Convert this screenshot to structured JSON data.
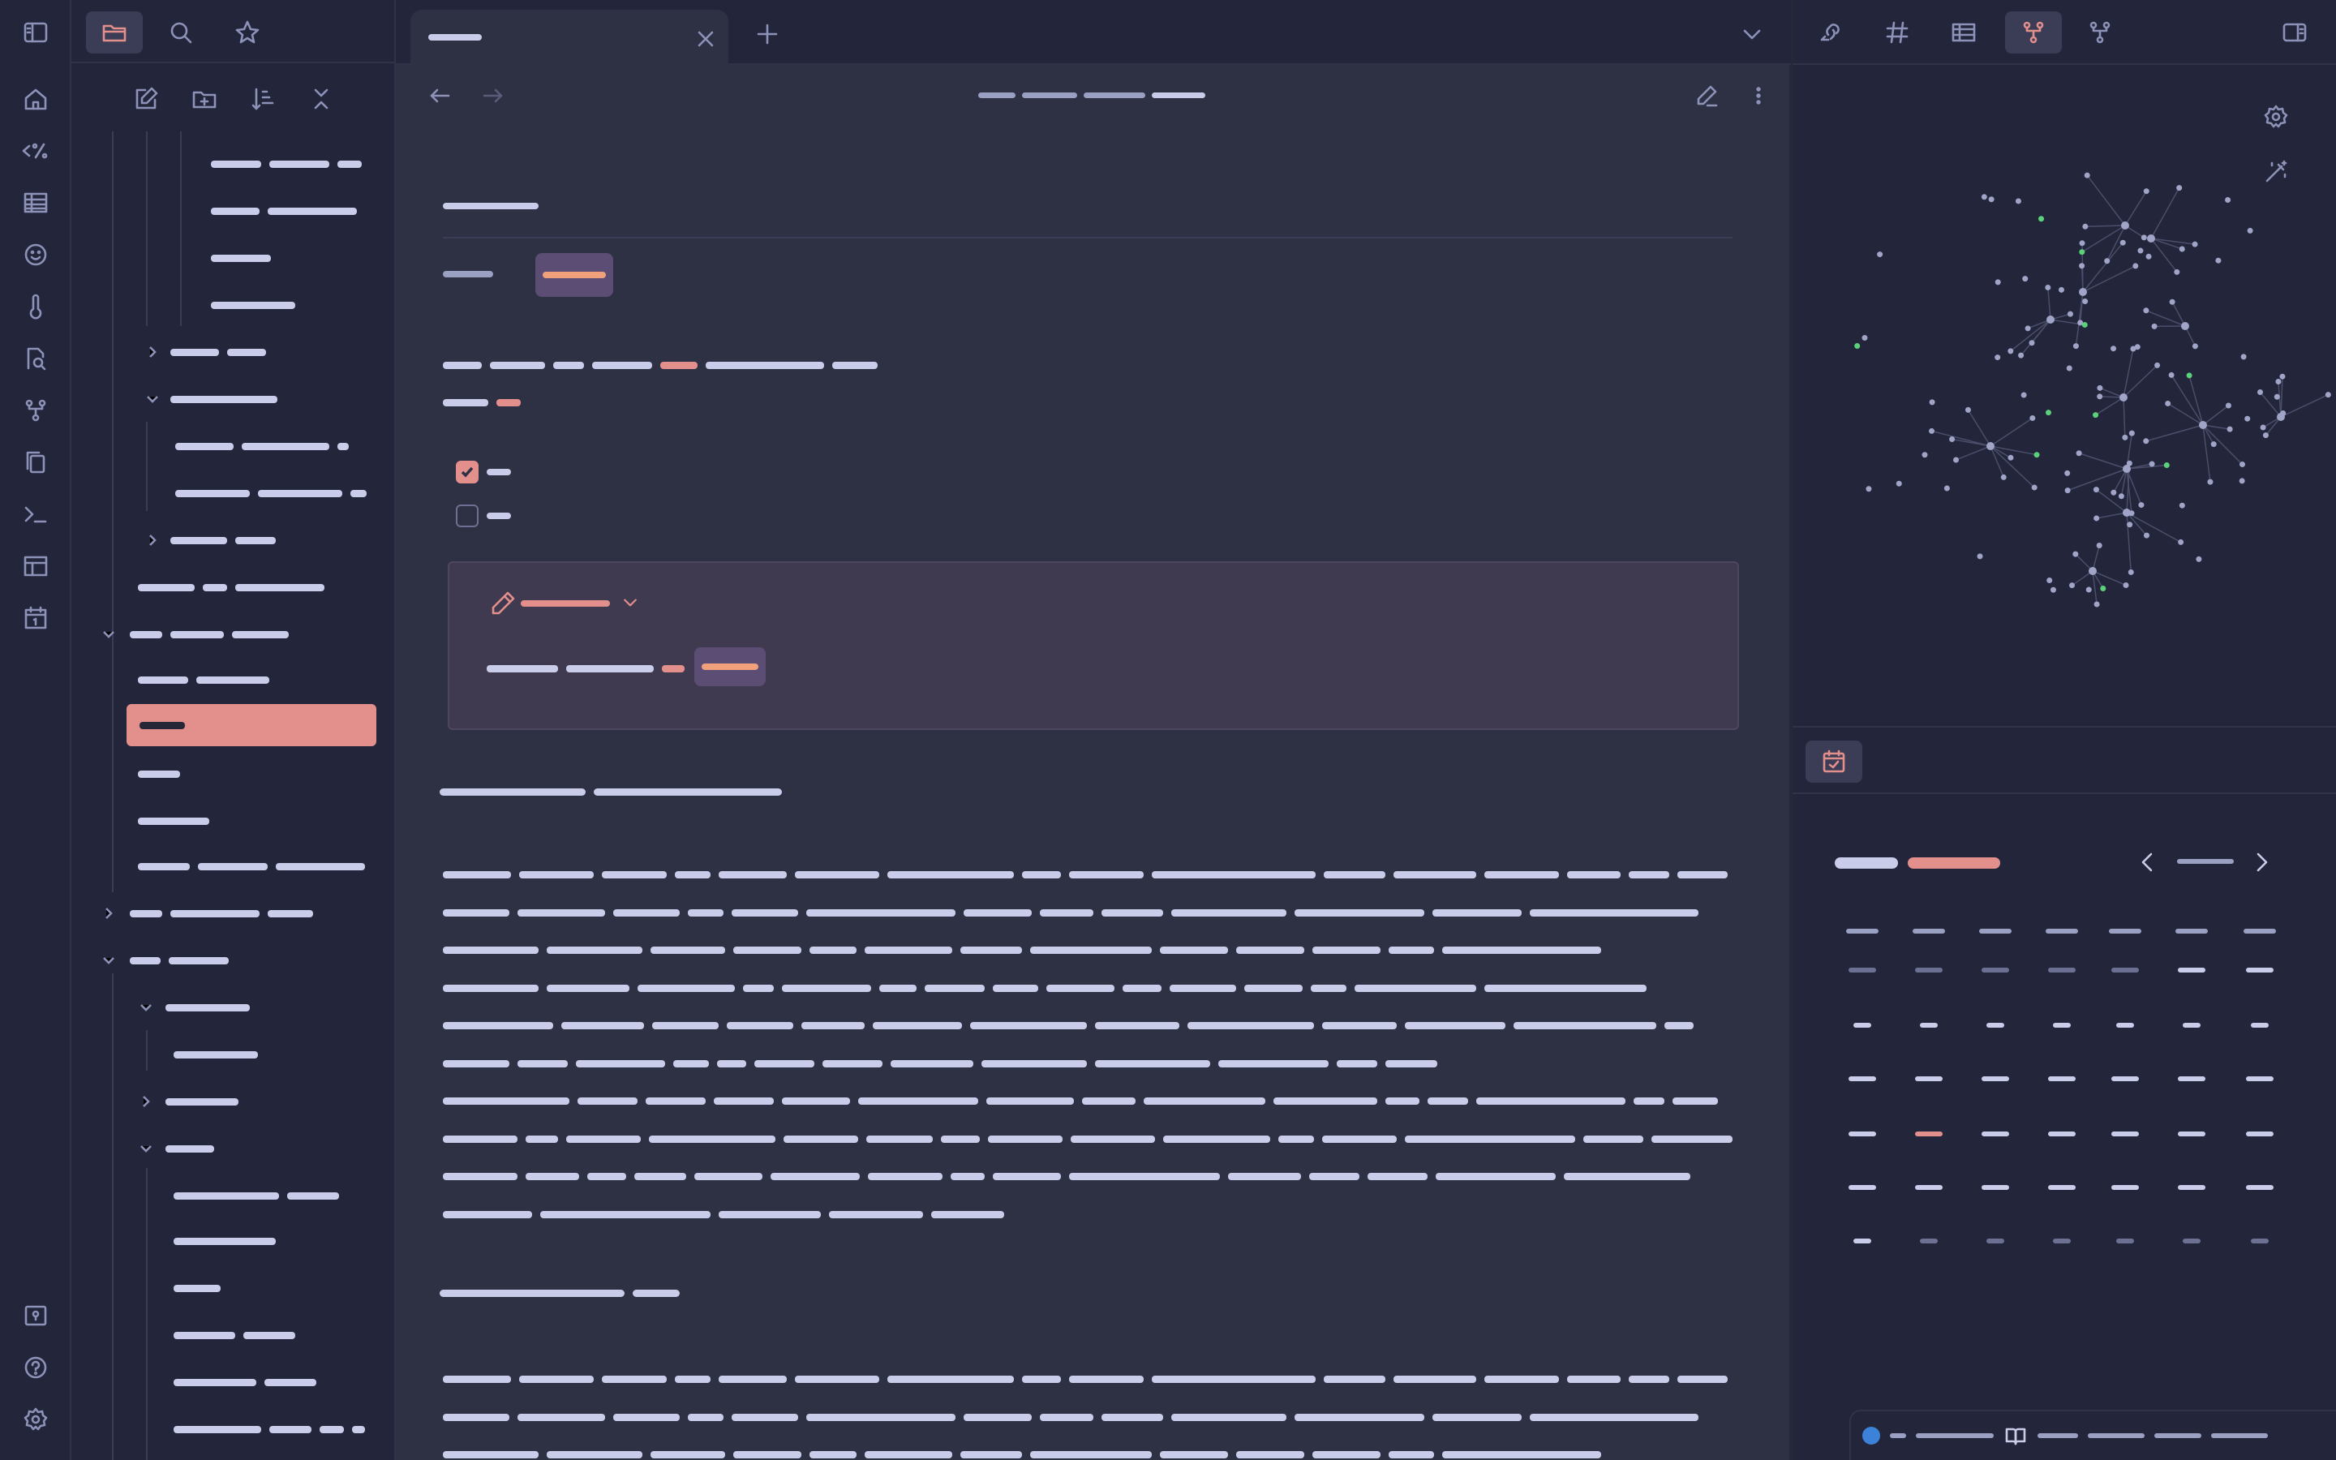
{
  "ribbon": {
    "items": [
      "home-icon",
      "templater-icon",
      "table-icon",
      "emoji-icon",
      "thermometer-icon",
      "search-doc-icon",
      "git-icon",
      "copy-icon",
      "terminal-icon",
      "layout-icon",
      "calendar-icon"
    ],
    "bottom": [
      "vault-icon",
      "help-icon",
      "settings-icon"
    ]
  },
  "explorer": {
    "toolbar": [
      "sidebar-toggle-icon",
      "folder-icon",
      "search-icon",
      "star-icon"
    ],
    "nav": [
      "new-note-icon",
      "new-folder-icon",
      "sort-icon",
      "collapse-all-icon"
    ]
  },
  "tabs": {
    "active_title": "▬▬▬▬▬",
    "close_label": "×",
    "new_label": "+"
  },
  "note": {
    "breadcrumb": "▬ / ▬ / ▬ / ▬",
    "properties_title": "▬▬▬▬▬▬",
    "property_key": "▬▬▬▬",
    "property_tag": "▬▬▬▬▬",
    "callout_title": "▬▬▬▬▬▬▬",
    "callout_tag": "▬▬▬▬▬",
    "tasks": [
      {
        "checked": true,
        "text": "▬"
      },
      {
        "checked": false,
        "text": "▬"
      }
    ]
  },
  "right_sidebar": {
    "tabs": [
      "backlinks-icon",
      "tags-icon",
      "table-icon",
      "graph-icon",
      "graph-outline-icon"
    ],
    "accent": "#e38f8c"
  },
  "calendar": {
    "month": "▬▬▬",
    "year": "▬▬▬▬",
    "today_label": "▬▬▬"
  },
  "colors": {
    "background": "#2e3044",
    "sidebar": "#23253a",
    "accent": "#e38f8c",
    "tag": "#f0a07a",
    "text": "#c9cdea"
  }
}
